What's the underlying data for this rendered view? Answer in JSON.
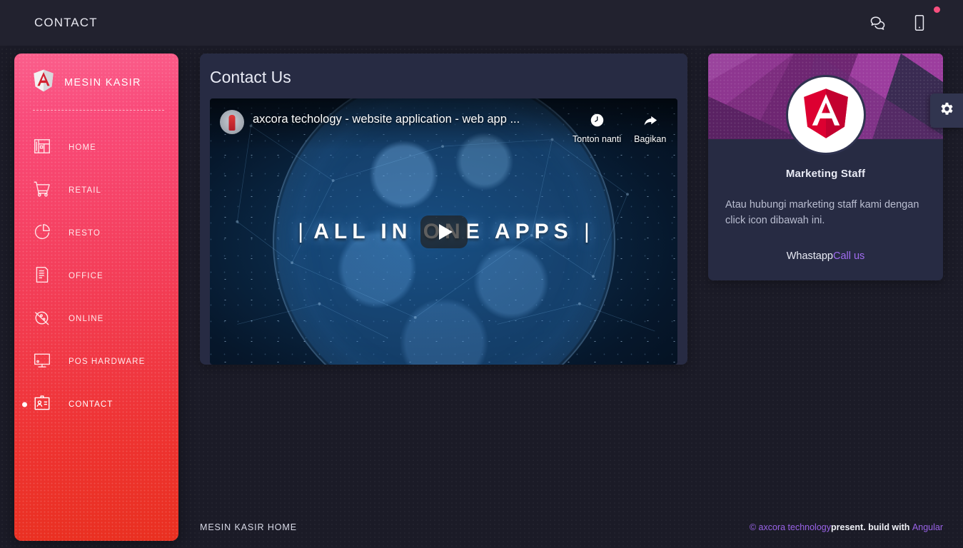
{
  "colors": {
    "accent_pink": "#f94a79",
    "accent_red": "#e93020",
    "card_bg": "#272b43",
    "page_bg": "#1b1b27",
    "purple_link": "#9a63e8",
    "banner_purple": "#7d2d7f"
  },
  "topbar": {
    "title": "CONTACT",
    "icons": [
      {
        "name": "chat-bubbles-icon",
        "label": "Chat"
      },
      {
        "name": "mobile-phone-icon",
        "label": "Mobile"
      }
    ],
    "notification_dot": true
  },
  "sidebar": {
    "brand": "MESIN KASIR",
    "brand_logo": "angular-shield-icon",
    "items": [
      {
        "label": "HOME",
        "icon": "dashboard-layout-icon",
        "active": false
      },
      {
        "label": "RETAIL",
        "icon": "shopping-cart-icon",
        "active": false
      },
      {
        "label": "RESTO",
        "icon": "pie-chart-icon",
        "active": false
      },
      {
        "label": "OFFICE",
        "icon": "document-icon",
        "active": false
      },
      {
        "label": "ONLINE",
        "icon": "globe-network-icon",
        "active": false
      },
      {
        "label": "POS HARDWARE",
        "icon": "monitor-icon",
        "active": false
      },
      {
        "label": "CONTACT",
        "icon": "id-card-icon",
        "active": true
      }
    ]
  },
  "main": {
    "card_title": "Contact Us",
    "video": {
      "channel_title": "axcora techology - website application - web app ...",
      "headline": "ALL IN ONE APPS",
      "actions": [
        {
          "label": "Tonton nanti",
          "icon": "clock-icon"
        },
        {
          "label": "Bagikan",
          "icon": "share-arrow-icon"
        }
      ],
      "play_button": "play-icon"
    }
  },
  "profile": {
    "avatar_icon": "angular-shield-icon",
    "name": "Marketing Staff",
    "description": "Atau hubungi marketing staff kami dengan click icon dibawah ini.",
    "links": [
      {
        "label": "Whastapp",
        "style": "plain"
      },
      {
        "label": "Call us",
        "style": "accent"
      }
    ]
  },
  "settings_tab": {
    "icon": "gear-icon",
    "label": "Settings"
  },
  "footer": {
    "left": "MESIN KASIR HOME",
    "copyright_symbol": "©",
    "brand": " axcora technology",
    "middle": "present. build with ",
    "framework": "Angular"
  }
}
